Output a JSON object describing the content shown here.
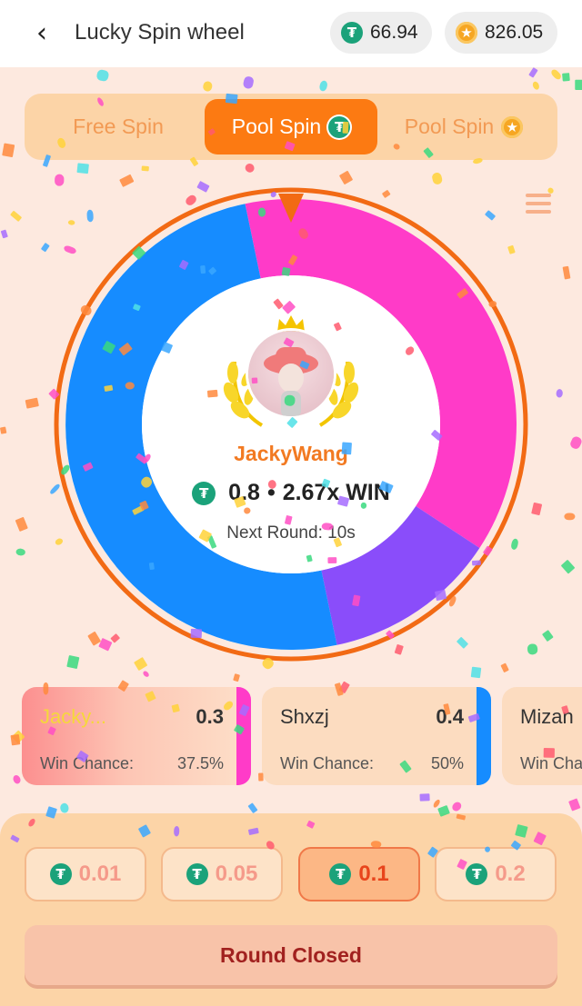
{
  "header": {
    "title": "Lucky Spin wheel",
    "usdt_balance": "66.94",
    "gold_balance": "826.05"
  },
  "tabs": [
    {
      "label": "Free Spin",
      "active": false,
      "icon": "none"
    },
    {
      "label": "Pool Spin",
      "active": true,
      "icon": "usdt-coin-icon"
    },
    {
      "label": "Pool Spin",
      "active": false,
      "icon": "gold-coin-icon"
    }
  ],
  "wheel": {
    "segments": [
      {
        "color": "#ff3bc8",
        "share": 0.375
      },
      {
        "color": "#8a4dfa",
        "share": 0.125
      },
      {
        "color": "#168cff",
        "share": 0.5
      }
    ],
    "winner_name": "JackyWang",
    "win_amount": "0.8",
    "win_multiplier": "2.67x WIN",
    "next_round": "Next Round: 10s"
  },
  "players": [
    {
      "name": "Jacky...",
      "amount": "0.3",
      "label": "Win Chance:",
      "chance": "37.5%",
      "color": "#ff3bc8"
    },
    {
      "name": "Shxzj",
      "amount": "0.4",
      "label": "Win Chance:",
      "chance": "50%",
      "color": "#168cff"
    },
    {
      "name": "Mizan",
      "amount": "",
      "label": "Win Cha",
      "chance": "",
      "color": "#8a4dfa"
    }
  ],
  "bets": [
    {
      "value": "0.01",
      "active": false
    },
    {
      "value": "0.05",
      "active": false
    },
    {
      "value": "0.1",
      "active": true
    },
    {
      "value": "0.2",
      "active": false
    }
  ],
  "action_label": "Round Closed",
  "colors": {
    "accent": "#fc7a12",
    "usdt": "#1ba27a",
    "gold": "#f6a623",
    "background": "#fde9df"
  }
}
